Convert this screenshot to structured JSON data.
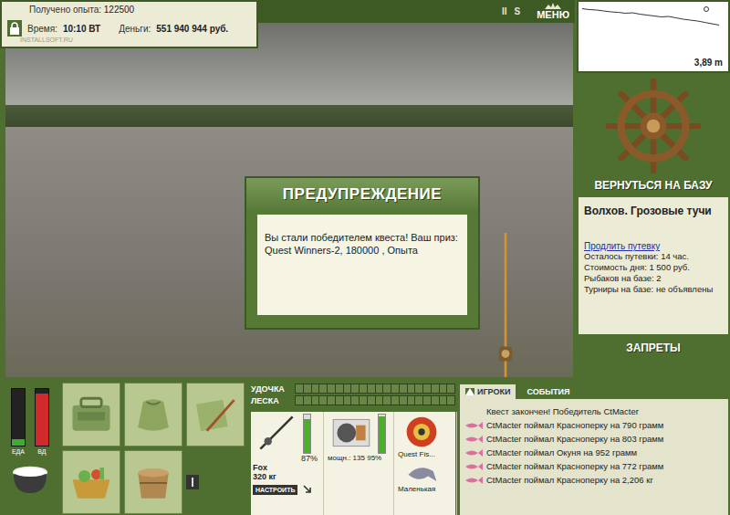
{
  "hud": {
    "watermark": "INSTALLSOFT.RU",
    "experience": {
      "label": "Получено опыта:",
      "value": "122500"
    },
    "time": {
      "label": "Время:",
      "value": "10:10 ВТ"
    },
    "money": {
      "label": "Деньги:",
      "value": "551 940 944 руб."
    }
  },
  "toolbar": {
    "buttons": [
      "II",
      "S"
    ],
    "menu": "МЕНЮ"
  },
  "depth": {
    "reading": "3,89 m",
    "profile": [
      0.3,
      0.5,
      0.6,
      0.8,
      1.0,
      1.1,
      1.3,
      1.2,
      1.5,
      1.7,
      1.9,
      2.1,
      2.0,
      2.3,
      2.6,
      2.8,
      3.0,
      3.3,
      3.6,
      3.89
    ]
  },
  "dialog": {
    "title": "ПРЕДУПРЕЖДЕНИЕ",
    "message": "Вы стали победителем квеста! Ваш приз: Quest Winners-2, 180000 , Опыта"
  },
  "base": {
    "return_button": "ВЕРНУТЬСЯ НА БАЗУ",
    "location": "Волхов. Грозовые тучи",
    "extend_link": "Продлить путевку",
    "details": [
      "Осталось путевки: 14 час.",
      "Стоимость дня: 1 500 руб.",
      "Рыбаков на базе: 2",
      "Турниры на базе: не объявлены"
    ],
    "bans_button": "ЗАПРЕТЫ"
  },
  "needs": [
    {
      "label": "ЕДА",
      "level": 0.12,
      "color": "#3fae2a"
    },
    {
      "label": "ВД",
      "level": 0.92,
      "color": "#d12a2a"
    }
  ],
  "tension": [
    {
      "label": "УДОЧКА",
      "level": 0
    },
    {
      "label": "ЛЕСКА",
      "level": 0
    }
  ],
  "tackle": {
    "rod": {
      "name": "Fox",
      "capacity": "320 кг",
      "condition": "87%",
      "level": 0.87,
      "button": "НАСТРОИТЬ"
    },
    "reel": {
      "power": "мощн.: 135",
      "condition": "95%",
      "level": 0.95
    },
    "lure": "Quest Fis...",
    "bait": "Маленькая"
  },
  "events": {
    "tabs": [
      {
        "label": "ИГРОКИ",
        "selected": true
      },
      {
        "label": "СОБЫТИЯ",
        "selected": false
      }
    ],
    "items": [
      {
        "kind": "notice",
        "text": "Квест закончен! Победитель CtMacter"
      },
      {
        "kind": "catch",
        "text": "CtMacter поймал Красноперку на 790 грамм"
      },
      {
        "kind": "catch",
        "text": "CtMacter поймал Красноперку на 803 грамм"
      },
      {
        "kind": "catch",
        "text": "CtMacter поймал Окуня на 952 грамм"
      },
      {
        "kind": "catch",
        "text": "CtMacter поймал Красноперку на 772 грамм"
      },
      {
        "kind": "catch",
        "text": "CtMacter поймал Красноперку на 2,206 кг"
      }
    ]
  }
}
